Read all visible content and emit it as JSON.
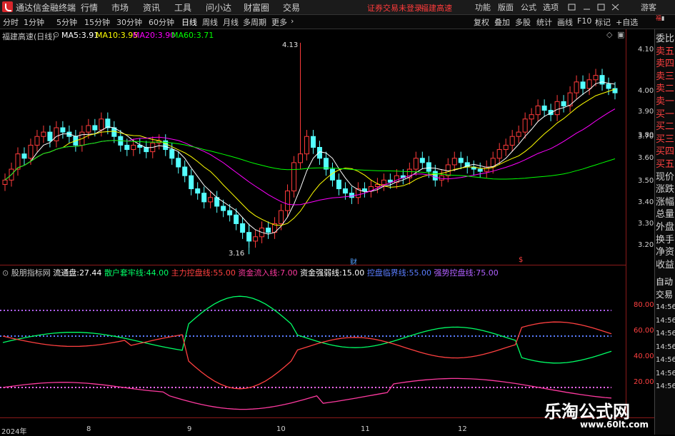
{
  "topbar": {
    "app_title": "通达信金融终端",
    "menu": [
      "行情",
      "市场",
      "资讯",
      "工具",
      "问小达",
      "财富圈",
      "交易"
    ],
    "login_notice": "证券交易未登录",
    "stock_name": "福建高速",
    "right_menu": [
      "功能",
      "版面",
      "公式",
      "选项"
    ],
    "guest": "游客"
  },
  "periods": [
    "分时",
    "1分钟",
    "5分钟",
    "15分钟",
    "30分钟",
    "60分钟",
    "日线",
    "周线",
    "月线",
    "多周期",
    "更多"
  ],
  "active_period": "日线",
  "toolbar": [
    "复权",
    "叠加",
    "多股",
    "统计",
    "画线",
    "F10",
    "标记",
    "+自选"
  ],
  "main_chart": {
    "title": "福建高速(日线)",
    "ma": [
      {
        "label": "MA5:",
        "value": "3.91",
        "color": "#ffffff"
      },
      {
        "label": "MA10:",
        "value": "3.95",
        "color": "#ffff00"
      },
      {
        "label": "MA20:",
        "value": "3.90",
        "color": "#ff00ff"
      },
      {
        "label": "MA60:",
        "value": "3.71",
        "color": "#00ff00"
      }
    ],
    "price_ticks": [
      "4.10",
      "4.00",
      "3.90",
      "3.80",
      "3.70",
      "3.60",
      "3.50",
      "3.40",
      "3.30",
      "3.20"
    ],
    "high_label": "4.13",
    "low_label": "3.16",
    "marker_cai": "财",
    "marker_dollar": "$"
  },
  "indicator": {
    "name": "股朋指标网",
    "items": [
      {
        "label": "流通盘:",
        "value": "27.44",
        "color": "#ffffff"
      },
      {
        "label": "散户套牢线:",
        "value": "44.00",
        "color": "#00ff66"
      },
      {
        "label": "主力控盘线:",
        "value": "55.00",
        "color": "#ff4040"
      },
      {
        "label": "资金流入线:",
        "value": "7.00",
        "color": "#ff3aa0"
      },
      {
        "label": "资金强弱线:",
        "value": "15.00",
        "color": "#ffffff"
      },
      {
        "label": "控盘临界线:",
        "value": "55.00",
        "color": "#5a7dff"
      },
      {
        "label": "强势控盘线:",
        "value": "75.00",
        "color": "#b060ff"
      }
    ],
    "ticks": [
      "80.00",
      "60.00",
      "40.00",
      "20.00"
    ]
  },
  "dates": [
    "2024年",
    "8",
    "9",
    "10",
    "11",
    "12"
  ],
  "right_panel": [
    "委比",
    "卖五",
    "卖四",
    "卖三",
    "卖二",
    "卖一",
    "买一",
    "买二",
    "买三",
    "买四",
    "买五",
    "现价",
    "涨跌",
    "涨幅",
    "总量",
    "外盘",
    "换手",
    "净资",
    "收益"
  ],
  "right_panel2": [
    "自动",
    "交易"
  ],
  "times": [
    "14:56",
    "14:56",
    "14:56",
    "14:56",
    "14:56",
    "14:56",
    "14:56"
  ],
  "watermark": {
    "name": "乐淘公式网",
    "url": "www.60lt.com"
  },
  "colors": {
    "up": "#ff3b3b",
    "down": "#54ffff",
    "bg": "#000000",
    "axis": "#8b1a1a"
  }
}
